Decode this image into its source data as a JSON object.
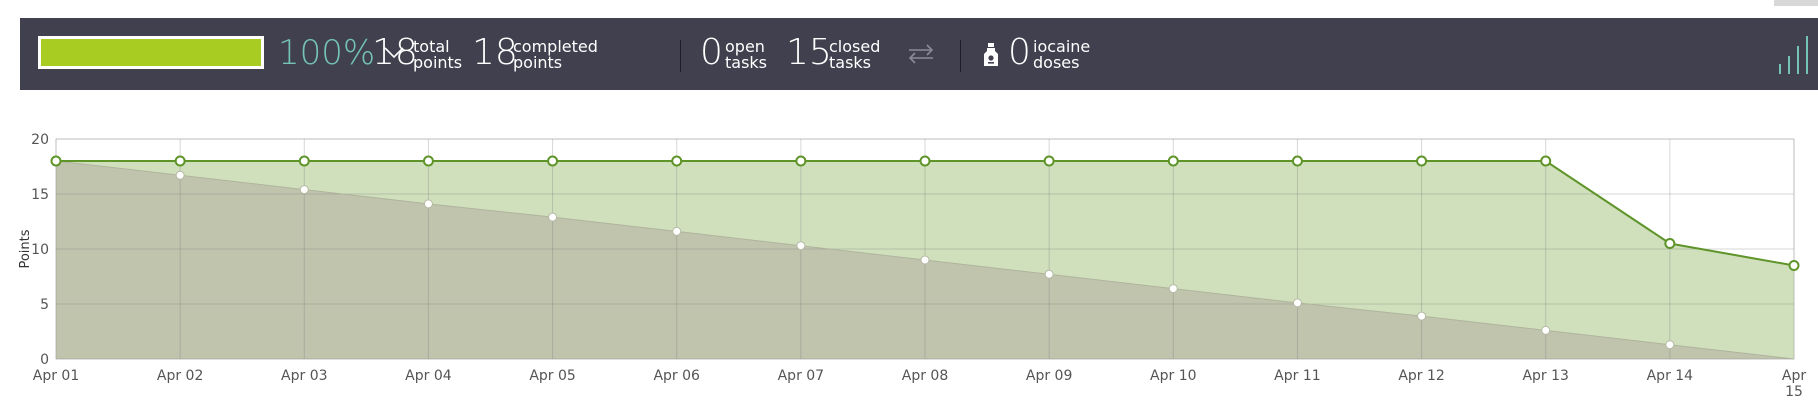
{
  "stats": {
    "progress_fraction": 1.0,
    "percent": "100%",
    "total_points": {
      "value": "18",
      "label_top": "total",
      "label_bottom": "points"
    },
    "completed_points": {
      "value": "18",
      "label_top": "completed",
      "label_bottom": "points"
    },
    "open_tasks": {
      "value": "0",
      "label_top": "open",
      "label_bottom": "tasks"
    },
    "closed_tasks": {
      "value": "15",
      "label_top": "closed",
      "label_bottom": "tasks"
    },
    "iocaine_doses": {
      "value": "0",
      "label_top": "iocaine",
      "label_bottom": "doses"
    }
  },
  "icons": {
    "progress_toggle": "chevron-down-icon",
    "swap": "swap-arrows-icon",
    "iocaine": "bottle-icon",
    "signal": "signal-bars-icon"
  },
  "colors": {
    "header_bg": "#40404f",
    "progress_fill": "#a8cc21",
    "percent_text": "#74c2b8",
    "signal_icon": "#74c2b8",
    "actual_line": "#5e9428",
    "actual_fill": "#d0e0bd",
    "ideal_fill": "#c0c4ad"
  },
  "chart_data": {
    "type": "area",
    "ylabel": "Points",
    "xlabel": "",
    "ylim": [
      0,
      20
    ],
    "yticks": [
      0,
      5,
      10,
      15,
      20
    ],
    "grid": true,
    "categories": [
      "Apr 01",
      "Apr 02",
      "Apr 03",
      "Apr 04",
      "Apr 05",
      "Apr 06",
      "Apr 07",
      "Apr 08",
      "Apr 09",
      "Apr 10",
      "Apr 11",
      "Apr 12",
      "Apr 13",
      "Apr 14",
      "Apr 15"
    ],
    "series": [
      {
        "values": [
          18,
          18,
          18,
          18,
          18,
          18,
          18,
          18,
          18,
          18,
          18,
          18,
          18,
          10.5,
          8.5
        ]
      },
      {
        "values": [
          18,
          16.7,
          15.4,
          14.1,
          12.9,
          11.6,
          10.3,
          9.0,
          7.7,
          6.4,
          5.1,
          3.9,
          2.6,
          1.3,
          0
        ]
      }
    ]
  }
}
